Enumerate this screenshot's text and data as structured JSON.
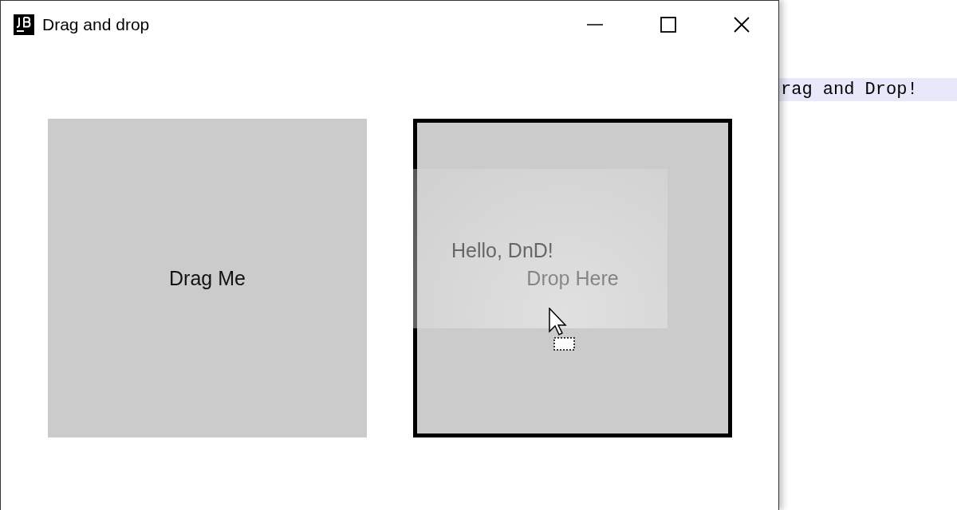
{
  "window": {
    "title": "Drag and drop"
  },
  "source": {
    "label": "Drag Me"
  },
  "target": {
    "label": "Drop Here",
    "highlighted": true
  },
  "drag_image": {
    "label": "Hello, DnD!"
  },
  "background_editor": {
    "line": "rag and Drop!"
  }
}
